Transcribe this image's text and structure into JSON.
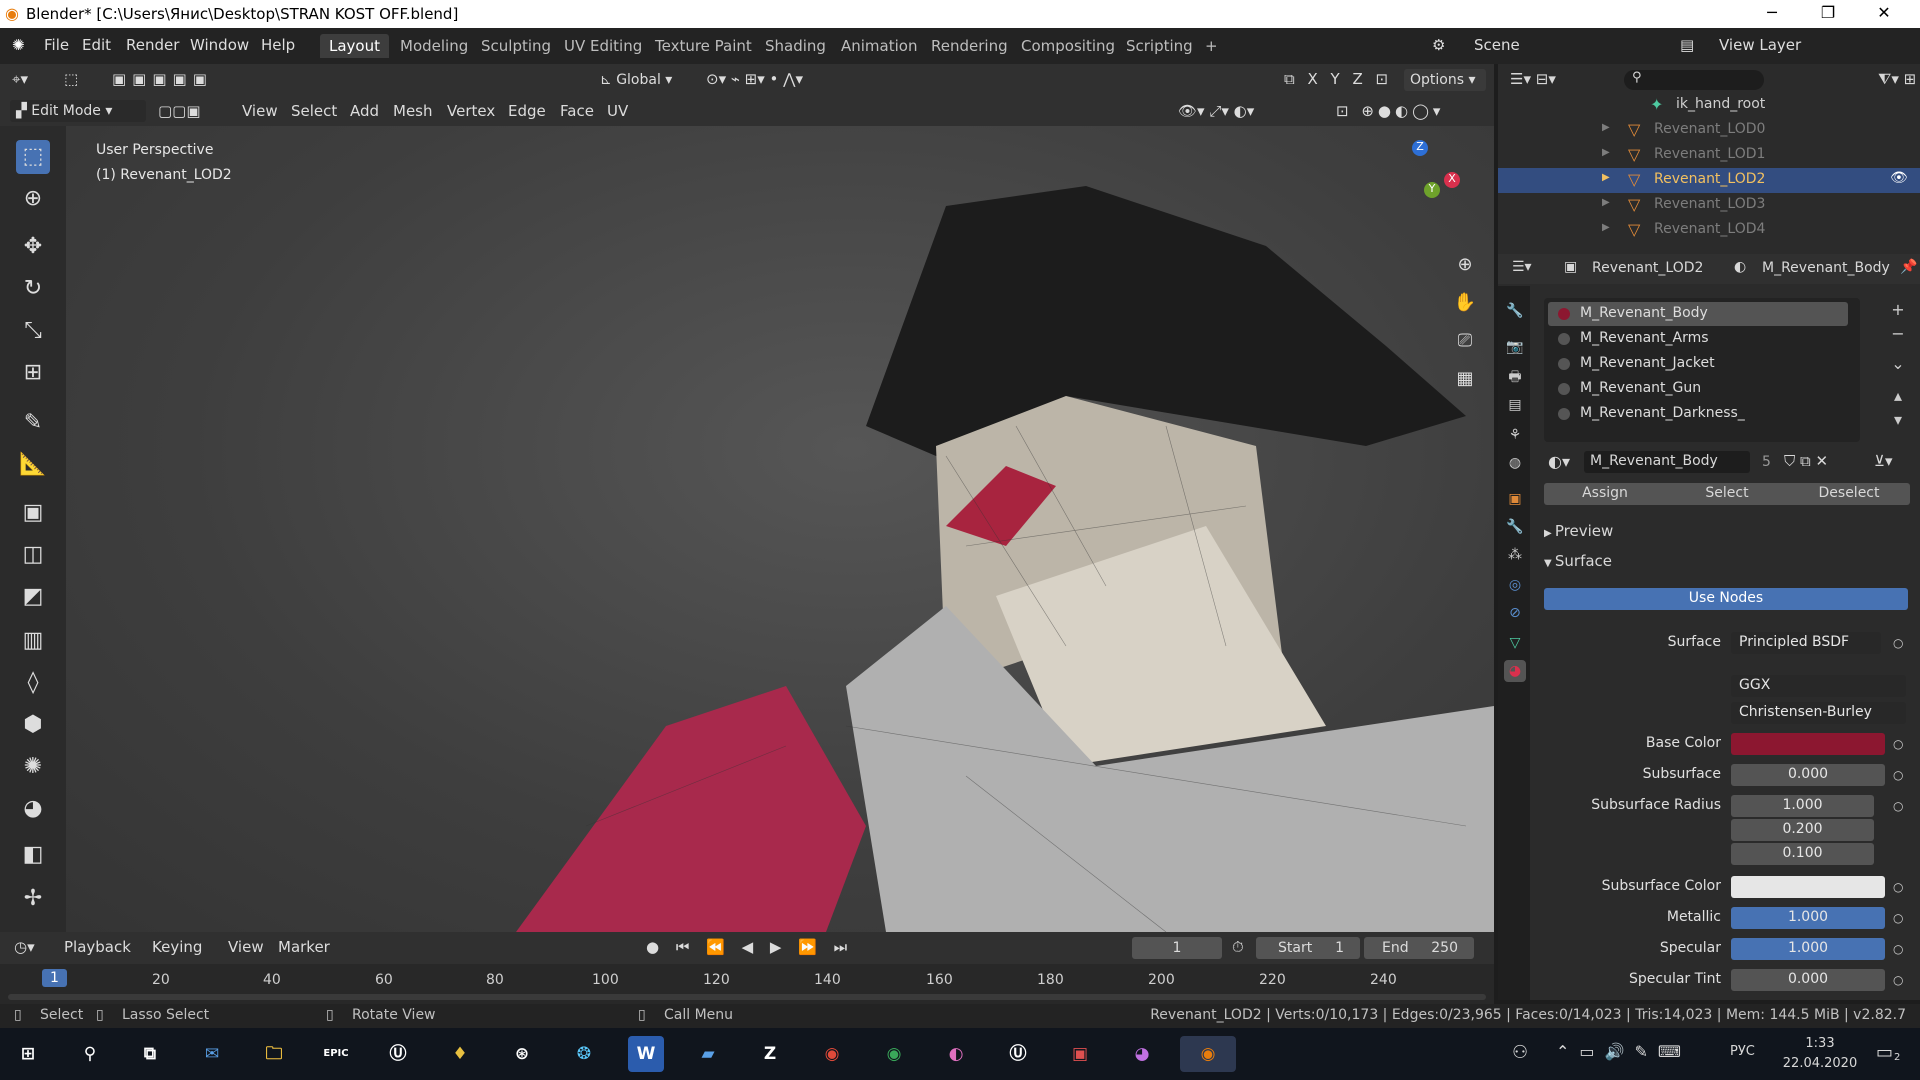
{
  "titlebar": {
    "title": "Blender* [C:\\Users\\Янис\\Desktop\\STRAN KOST OFF.blend]",
    "min": "─",
    "max": "❐",
    "close": "✕"
  },
  "menu": {
    "items": [
      "File",
      "Edit",
      "Render",
      "Window",
      "Help"
    ]
  },
  "workspaces": [
    "Layout",
    "Modeling",
    "Sculpting",
    "UV Editing",
    "Texture Paint",
    "Shading",
    "Animation",
    "Rendering",
    "Compositing",
    "Scripting",
    "+"
  ],
  "scene": {
    "scene_label": "Scene",
    "view_layer_label": "View Layer"
  },
  "header": {
    "orientation": "Global",
    "options": "Options",
    "mode": "Edit Mode",
    "menus": [
      "View",
      "Select",
      "Add",
      "Mesh",
      "Vertex",
      "Edge",
      "Face",
      "UV"
    ]
  },
  "viewport": {
    "perspective": "User Perspective",
    "object": "(1) Revenant_LOD2",
    "gizmo": {
      "z": "Z",
      "y": "Y",
      "x": "X"
    }
  },
  "outliner": {
    "root": "ik_hand_root",
    "items": [
      "Revenant_LOD0",
      "Revenant_LOD1",
      "Revenant_LOD2",
      "Revenant_LOD3",
      "Revenant_LOD4"
    ]
  },
  "properties": {
    "object": "Revenant_LOD2",
    "material": "M_Revenant_Body",
    "slots": [
      "M_Revenant_Body",
      "M_Revenant_Arms",
      "M_Revenant_Jacket",
      "M_Revenant_Gun",
      "M_Revenant_Darkness_"
    ],
    "active_material": "M_Revenant_Body",
    "users": "5",
    "assign": "Assign",
    "select": "Select",
    "deselect": "Deselect",
    "preview": "Preview",
    "surface_panel": "Surface",
    "use_nodes": "Use Nodes",
    "surface_label": "Surface",
    "surface_value": "Principled BSDF",
    "distribution": "GGX",
    "subsurface_method": "Christensen-Burley",
    "base_color_label": "Base Color",
    "base_color": "#8c1730",
    "subsurface_label": "Subsurface",
    "subsurface": "0.000",
    "ss_radius_label": "Subsurface Radius",
    "ss_radius": [
      "1.000",
      "0.200",
      "0.100"
    ],
    "ss_color_label": "Subsurface Color",
    "ss_color": "#e6e6e6",
    "metallic_label": "Metallic",
    "metallic": "1.000",
    "specular_label": "Specular",
    "specular": "1.000",
    "spec_tint_label": "Specular Tint",
    "spec_tint": "0.000"
  },
  "timeline": {
    "menus": [
      "Playback",
      "Keying",
      "View",
      "Marker"
    ],
    "current": "1",
    "start_label": "Start",
    "start": "1",
    "end_label": "End",
    "end": "250",
    "ticks": [
      "1",
      "20",
      "40",
      "60",
      "80",
      "100",
      "120",
      "140",
      "160",
      "180",
      "200",
      "220",
      "240"
    ]
  },
  "status": {
    "select": "Select",
    "lasso": "Lasso Select",
    "rotate": "Rotate View",
    "call_menu": "Call Menu",
    "stats": "Revenant_LOD2 | Verts:0/10,173 | Edges:0/23,965 | Faces:0/14,023 | Tris:14,023 | Mem: 144.5 MiB | v2.82.7"
  },
  "taskbar": {
    "lang": "РУС",
    "time": "1:33",
    "date": "22.04.2020",
    "notif": "2",
    "epic": "EPIC"
  }
}
